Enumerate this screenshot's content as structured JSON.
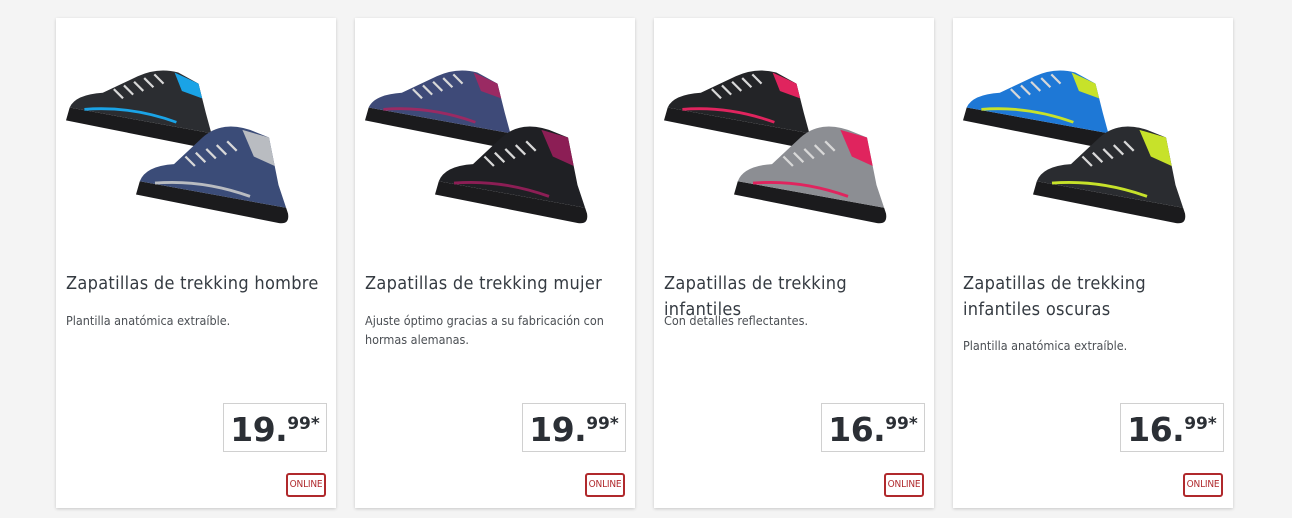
{
  "products": [
    {
      "title": "Zapatillas de trekking hombre",
      "description": "Plantilla anatómica extraíble.",
      "price_integer": "19.",
      "price_decimal": "99",
      "price_suffix": "*",
      "badge": "ONLINE",
      "image_icon": "hiking-shoes-men-icon",
      "colors": {
        "shoe_a": "#2b2d31",
        "accent_a": "#1aa3e6",
        "shoe_b": "#3b4c78",
        "accent_b": "#b9bcc1"
      }
    },
    {
      "title": "Zapatillas de trekking mujer",
      "description": "Ajuste óptimo gracias a su fabricación con hormas alemanas.",
      "price_integer": "19.",
      "price_decimal": "99",
      "price_suffix": "*",
      "badge": "ONLINE",
      "image_icon": "hiking-shoes-women-icon",
      "colors": {
        "shoe_a": "#3e4a78",
        "accent_a": "#9a2a63",
        "shoe_b": "#1f2024",
        "accent_b": "#8c1e55"
      }
    },
    {
      "title": "Zapatillas de trekking infantiles",
      "description": "Con detalles reflectantes.",
      "price_integer": "16.",
      "price_decimal": "99",
      "price_suffix": "*",
      "badge": "ONLINE",
      "image_icon": "hiking-shoes-kids-icon",
      "colors": {
        "shoe_a": "#232427",
        "accent_a": "#e0245e",
        "shoe_b": "#8c8e93",
        "accent_b": "#e0245e"
      }
    },
    {
      "title": "Zapatillas de trekking infantiles oscuras",
      "description": "Plantilla anatómica extraíble.",
      "price_integer": "16.",
      "price_decimal": "99",
      "price_suffix": "*",
      "badge": "ONLINE",
      "image_icon": "hiking-shoes-kids-dark-icon",
      "colors": {
        "shoe_a": "#1e78d6",
        "accent_a": "#c7e22a",
        "shoe_b": "#2a2c30",
        "accent_b": "#c7e22a"
      }
    }
  ]
}
